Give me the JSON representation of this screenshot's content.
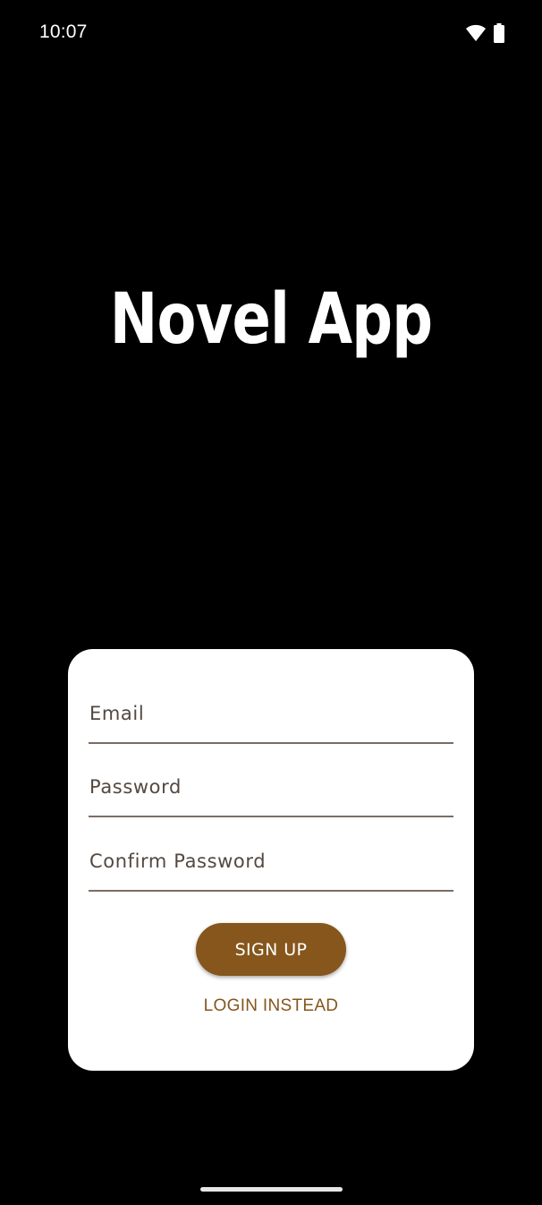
{
  "status_bar": {
    "time": "10:07",
    "icons": [
      "wifi-icon",
      "battery-icon"
    ]
  },
  "app": {
    "title": "Novel App"
  },
  "signup_form": {
    "email_placeholder": "Email",
    "password_placeholder": "Password",
    "confirm_password_placeholder": "Confirm Password",
    "signup_label": "SIGN UP",
    "login_label": "LOGIN INSTEAD"
  },
  "colors": {
    "background": "#000000",
    "card": "#ffffff",
    "accent": "#86561c",
    "field_text": "#544840",
    "underline": "#7d6d63"
  }
}
